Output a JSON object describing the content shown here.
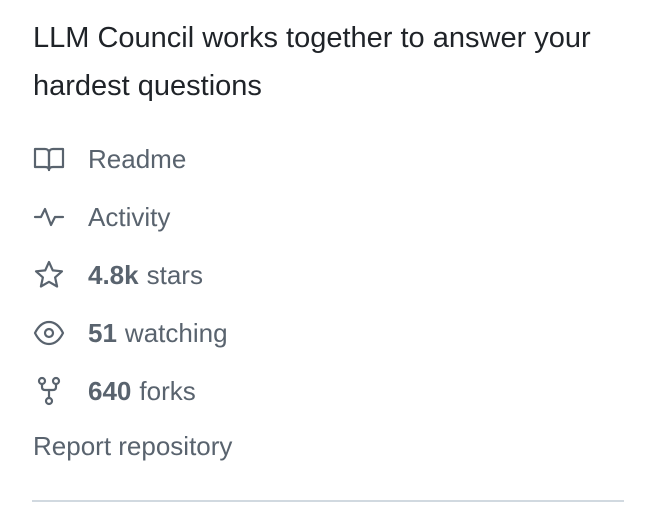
{
  "about": {
    "description": "LLM Council works together to answer your hardest questions",
    "items": {
      "readme": {
        "label": "Readme",
        "icon": "book-icon"
      },
      "activity": {
        "label": "Activity",
        "icon": "pulse-icon"
      },
      "stars": {
        "count": "4.8k",
        "label": "stars",
        "icon": "star-icon"
      },
      "watching": {
        "count": "51",
        "label": "watching",
        "icon": "eye-icon"
      },
      "forks": {
        "count": "640",
        "label": "forks",
        "icon": "repo-forked-icon"
      }
    },
    "report_label": "Report repository"
  },
  "colors": {
    "text_primary": "#1f2328",
    "text_muted": "#59636e",
    "divider": "#d1d9e0"
  }
}
